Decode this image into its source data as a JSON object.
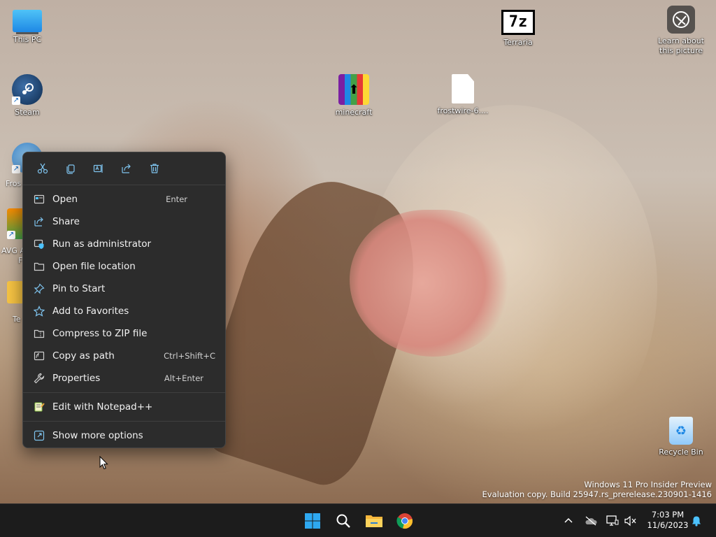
{
  "desktop": {
    "icons": {
      "this_pc": "This PC",
      "steam": "Steam",
      "terraria": "Terraria",
      "sevenz_glyph": "7z",
      "minecraft": "minecraft",
      "frostwire": "frostwire-6....",
      "learn_line1": "Learn about",
      "learn_line2": "this picture",
      "recycle_bin": "Recycle Bin"
    },
    "partial_labels": {
      "fros": "Fros",
      "avg_a": "AVG A",
      "avg_f": "F",
      "te": "Te"
    }
  },
  "context_menu": {
    "toolbar": [
      "cut-icon",
      "copy-icon",
      "rename-icon",
      "share-icon",
      "delete-icon"
    ],
    "items": [
      {
        "label": "Open",
        "shortcut": "Enter",
        "icon": "open-icon"
      },
      {
        "label": "Share",
        "shortcut": "",
        "icon": "share-icon"
      },
      {
        "label": "Run as administrator",
        "shortcut": "",
        "icon": "shield-icon"
      },
      {
        "label": "Open file location",
        "shortcut": "",
        "icon": "folder-icon"
      },
      {
        "label": "Pin to Start",
        "shortcut": "",
        "icon": "pin-icon"
      },
      {
        "label": "Add to Favorites",
        "shortcut": "",
        "icon": "star-icon"
      },
      {
        "label": "Compress to ZIP file",
        "shortcut": "",
        "icon": "zip-folder-icon"
      },
      {
        "label": "Copy as path",
        "shortcut": "Ctrl+Shift+C",
        "icon": "copy-path-icon"
      },
      {
        "label": "Properties",
        "shortcut": "Alt+Enter",
        "icon": "wrench-icon"
      }
    ],
    "extra": {
      "label": "Edit with Notepad++",
      "icon": "notepad-plus-plus-icon"
    },
    "more": {
      "label": "Show more options",
      "icon": "more-options-icon"
    }
  },
  "watermark": {
    "line1": "Windows 11 Pro Insider Preview",
    "line2": "Evaluation copy. Build 25947.rs_prerelease.230901-1416"
  },
  "taskbar": {
    "pinned": [
      "windows-start-icon",
      "search-icon",
      "file-explorer-icon",
      "chrome-icon"
    ],
    "clock_time": "7:03 PM",
    "clock_date": "11/6/2023"
  },
  "colors": {
    "menu_bg": "#2c2c2c",
    "accent_blue": "#4cc2ff",
    "taskbar_bg": "#1c1c1c"
  }
}
